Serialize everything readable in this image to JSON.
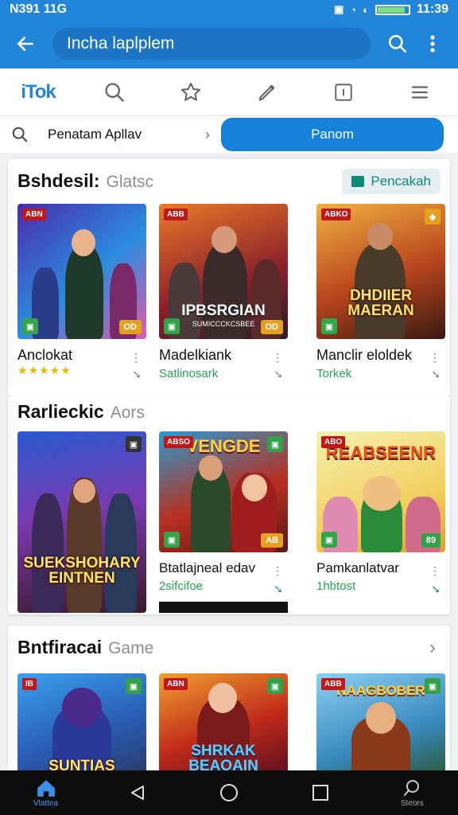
{
  "status": {
    "left_text": "N391 11G",
    "time": "11:39",
    "battery_level": 0.9
  },
  "appbar": {
    "search_text": "Incha laplplem"
  },
  "tabs": [
    {
      "name": "logo",
      "label": "iTok"
    },
    {
      "name": "search-icon"
    },
    {
      "name": "star-icon"
    },
    {
      "name": "pen-icon"
    },
    {
      "name": "square-icon"
    },
    {
      "name": "menu-icon"
    }
  ],
  "filter": {
    "label": "Penatam Apllav",
    "button": "Panom"
  },
  "section1": {
    "title": "Bshdesil:",
    "subtitle": "Glatsc",
    "chip": "Pencakah",
    "items": [
      {
        "name": "Anclokat",
        "rating": "★★★★★",
        "badge_tl": "ABN",
        "badge_br": "OD",
        "art_title": ""
      },
      {
        "name": "Madelkiank",
        "sub": "Satlinosark",
        "badge_tl": "ABB",
        "art_title": "IPBSRGIAN",
        "art_sub": "SUMICCCKCSBEE",
        "badge_br": "OD"
      },
      {
        "name": "Manclir eloldek",
        "sub": "Torkek",
        "badge_tl": "ABKO",
        "art_title": "DHDIIER MAERAN"
      }
    ]
  },
  "section2": {
    "title": "Rarlieckic",
    "subtitle": "Aors",
    "items": [
      {
        "badge_tl": "",
        "art_title": "SUEKSHOHARY EINTNEN"
      },
      {
        "name": "Btatlajneal edav",
        "sub": "2sifcifoe",
        "badge_tl": "ABSO",
        "art_title": "VENGDE",
        "badge_br": "AB"
      },
      {
        "name": "Pamkanlatvar",
        "sub": "1hbtost",
        "badge_tl": "ABO",
        "art_title": "REABSEENR",
        "badge_br": "89"
      }
    ]
  },
  "section3": {
    "title": "Bntfiracai",
    "subtitle": "Game",
    "items": [
      {
        "badge_tl": "IB",
        "art_title": "SUNTIAS"
      },
      {
        "badge_tl": "ABN",
        "art_title": "SHRKAK BEAOAIN"
      },
      {
        "badge_tl": "ABB",
        "art_title": "NAAGBOBER"
      }
    ]
  },
  "nav": {
    "home_label": "Vlattea",
    "search_label": "Steors"
  },
  "colors": {
    "primary": "#2186d9",
    "accent_green": "#23a35a"
  }
}
